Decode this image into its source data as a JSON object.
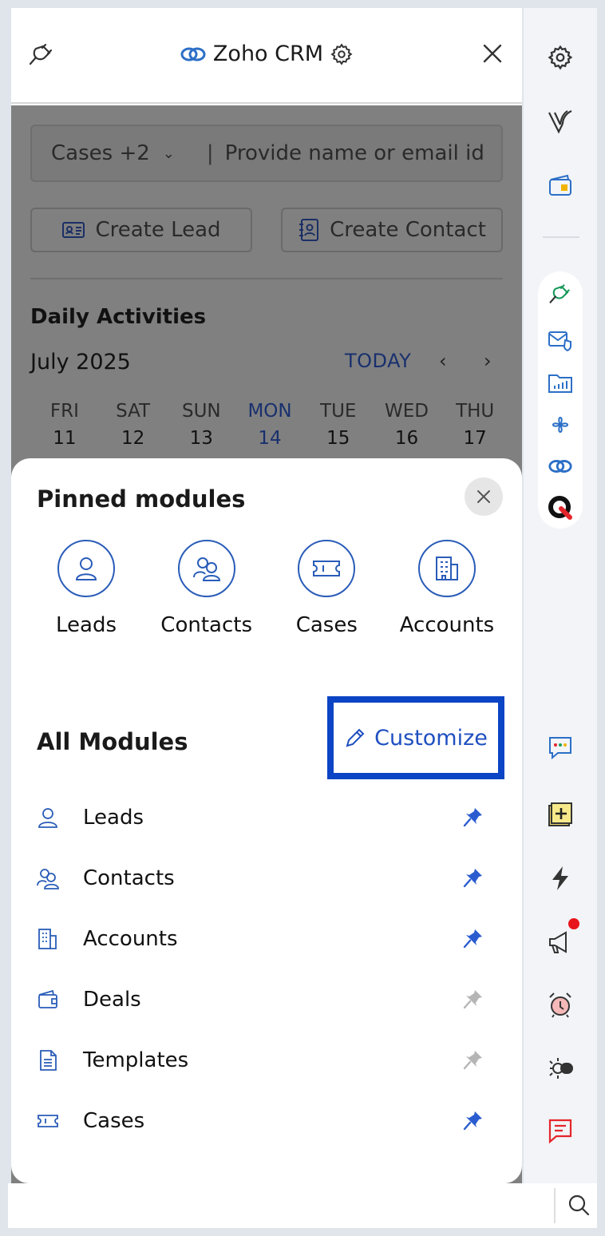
{
  "header": {
    "title": "Zoho CRM"
  },
  "search": {
    "module_selector": "Cases +2",
    "placeholder": "Provide name or email id"
  },
  "actions": {
    "create_lead": "Create Lead",
    "create_contact": "Create Contact"
  },
  "calendar": {
    "section_title": "Daily Activities",
    "month": "July 2025",
    "today_label": "TODAY",
    "prev": "‹",
    "next": "›",
    "days": [
      {
        "name": "FRI",
        "date": "11"
      },
      {
        "name": "SAT",
        "date": "12"
      },
      {
        "name": "SUN",
        "date": "13"
      },
      {
        "name": "MON",
        "date": "14"
      },
      {
        "name": "TUE",
        "date": "15"
      },
      {
        "name": "WED",
        "date": "16"
      },
      {
        "name": "THU",
        "date": "17"
      }
    ]
  },
  "sheet": {
    "pinned_title": "Pinned modules",
    "pinned": [
      {
        "label": "Leads",
        "icon": "user-icon"
      },
      {
        "label": "Contacts",
        "icon": "contacts-icon"
      },
      {
        "label": "Cases",
        "icon": "ticket-icon"
      },
      {
        "label": "Accounts",
        "icon": "building-icon"
      }
    ],
    "all_title": "All Modules",
    "customize_label": "Customize",
    "modules": [
      {
        "label": "Leads",
        "pinned": true
      },
      {
        "label": "Contacts",
        "pinned": true
      },
      {
        "label": "Accounts",
        "pinned": true
      },
      {
        "label": "Deals",
        "pinned": false
      },
      {
        "label": "Templates",
        "pinned": false
      },
      {
        "label": "Cases",
        "pinned": true
      }
    ]
  },
  "colors": {
    "accent": "#1f4fc0",
    "highlight_border": "#0b44c4",
    "pin_active": "#2a5cd0",
    "pin_inactive": "#b5b5b5"
  }
}
